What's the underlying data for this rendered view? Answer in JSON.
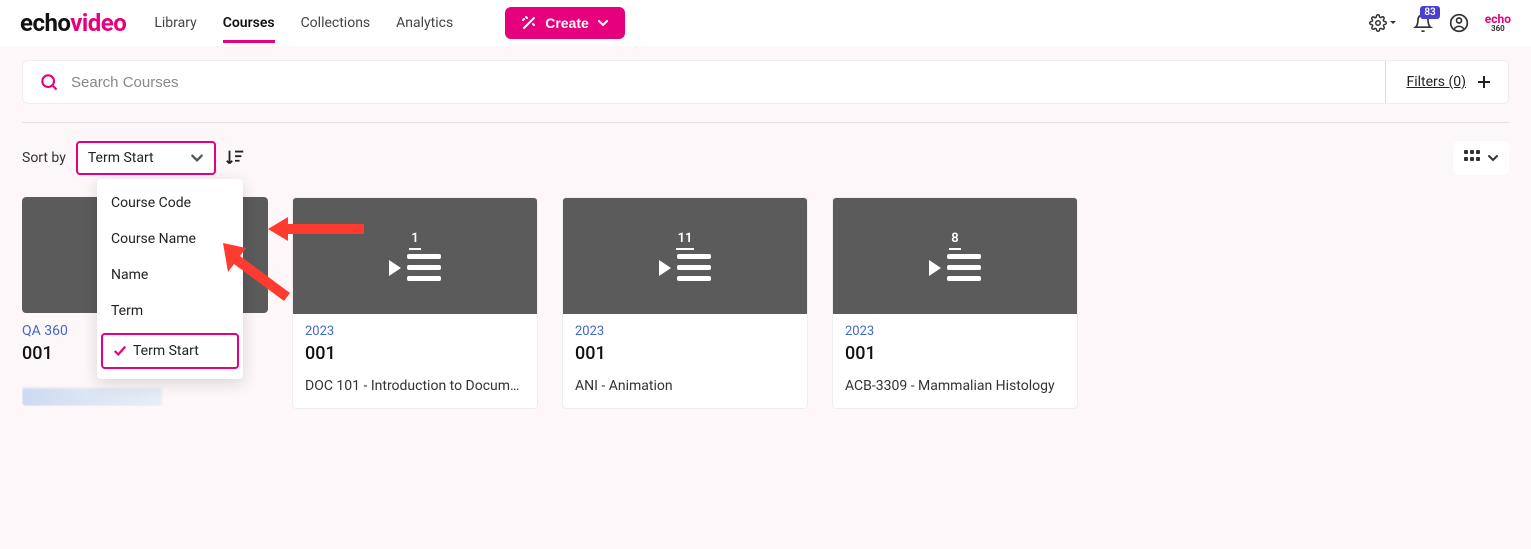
{
  "logo": {
    "part1": "echo",
    "part2": "video"
  },
  "nav": {
    "items": [
      "Library",
      "Courses",
      "Collections",
      "Analytics"
    ],
    "active_index": 1,
    "create_label": "Create"
  },
  "header": {
    "notification_count": "83",
    "small_logo": "echo",
    "small_logo_sub": "360"
  },
  "search": {
    "placeholder": "Search Courses",
    "filters_label": "Filters (0)"
  },
  "sort": {
    "label": "Sort by",
    "selected": "Term Start",
    "options": [
      "Course Code",
      "Course Name",
      "Name",
      "Term",
      "Term Start"
    ],
    "selected_index": 4
  },
  "cards": [
    {
      "year": "",
      "section": "001",
      "title": "QA 360",
      "count": ""
    },
    {
      "year": "2023",
      "section": "001",
      "title": "DOC 101 - Introduction to Document...",
      "count": "1"
    },
    {
      "year": "2023",
      "section": "001",
      "title": "ANI - Animation",
      "count": "11"
    },
    {
      "year": "2023",
      "section": "001",
      "title": "ACB-3309 - Mammalian Histology",
      "count": "8"
    }
  ]
}
